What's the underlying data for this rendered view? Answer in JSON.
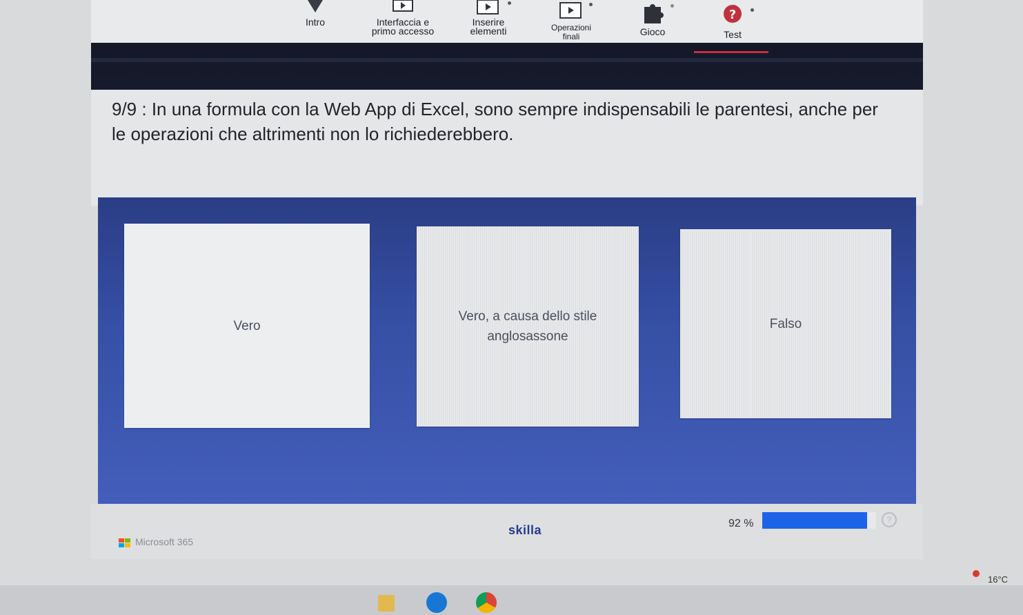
{
  "nav": {
    "items": [
      {
        "label": "Intro"
      },
      {
        "label": "Interfaccia e\nprimo accesso"
      },
      {
        "label": "Inserire\nelementi"
      },
      {
        "label": "Operazioni\nfinali"
      },
      {
        "label": "Gioco"
      },
      {
        "label": "Test"
      }
    ],
    "active": "Test"
  },
  "question": {
    "text": "9/9 : In una formula con la Web App di Excel, sono sempre indispensabili le parentesi, anche per le operazioni che altrimenti non lo richiederebbero."
  },
  "answers": [
    {
      "label": "Vero"
    },
    {
      "label": "Vero, a causa dello stile anglosassone"
    },
    {
      "label": "Falso"
    }
  ],
  "footer": {
    "partner": "Microsoft 365",
    "brand": "skilla",
    "progress_text": "92 %",
    "progress_value": 92,
    "help_icon": "?"
  },
  "taskbar": {
    "temperature": "16°C"
  },
  "colors": {
    "accent_red": "#c62f3f",
    "panel_blue": "#3650a5",
    "progress_blue": "#1d63e8"
  }
}
